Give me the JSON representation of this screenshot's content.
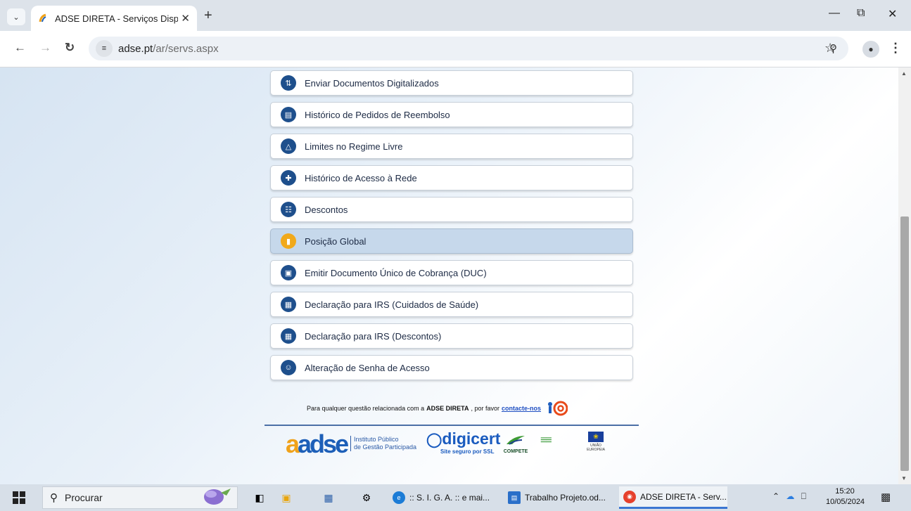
{
  "browser": {
    "tab_title": "ADSE DIRETA - Serviços Disponí",
    "url_host": "adse.pt",
    "url_path": "/ar/servs.aspx",
    "new_tab_glyph": "+"
  },
  "menu_items": [
    {
      "label": "Enviar Documentos Digitalizados",
      "icon": "upload-documents-icon"
    },
    {
      "label": "Histórico de Pedidos de Reembolso",
      "icon": "receipt-history-icon"
    },
    {
      "label": "Limites no Regime Livre",
      "icon": "warning-triangle-icon"
    },
    {
      "label": "Histórico de Acesso à Rede",
      "icon": "document-plus-icon"
    },
    {
      "label": "Descontos",
      "icon": "documents-icon"
    },
    {
      "label": "Posição Global",
      "icon": "bar-chart-icon",
      "active": true
    },
    {
      "label": "Emitir Documento Único de Cobrança (DUC)",
      "icon": "invoice-icon"
    },
    {
      "label": "Declaração para IRS (Cuidados de Saúde)",
      "icon": "tax-document-icon"
    },
    {
      "label": "Declaração para IRS (Descontos)",
      "icon": "tax-document-icon"
    },
    {
      "label": "Alteração de Senha de Acesso",
      "icon": "user-key-icon"
    }
  ],
  "footer": {
    "contact_prefix": "Para qualquer questão relacionada com a",
    "contact_brand": "ADSE DIRETA",
    "contact_middle": ", por favor",
    "contact_link": "contacte-nos",
    "adse_logo": "adse",
    "adse_sub_line1": "Instituto Público",
    "adse_sub_line2": "de Gestão Participada",
    "digicert_name": "digicert",
    "digicert_sub": "Site seguro por SSL",
    "compete": "COMPETE",
    "eu_text": "UNIÃO EUROPEIA"
  },
  "taskbar": {
    "search_placeholder": "Procurar",
    "apps": [
      {
        "label": ":: S. I. G. A. :: e mai...",
        "color": "#1c7cd6"
      },
      {
        "label": "Trabalho Projeto.od...",
        "color": "#2a6fc9"
      },
      {
        "label": "ADSE DIRETA - Serv...",
        "color": "#e6402c",
        "active": true
      }
    ],
    "time": "15:20",
    "date": "10/05/2024"
  },
  "colors": {
    "menu_icon_bg": "#1e4f8c",
    "active_item_bg": "#c6d8eb",
    "active_icon_bg": "#f1a91b",
    "link": "#1f4fc2"
  }
}
